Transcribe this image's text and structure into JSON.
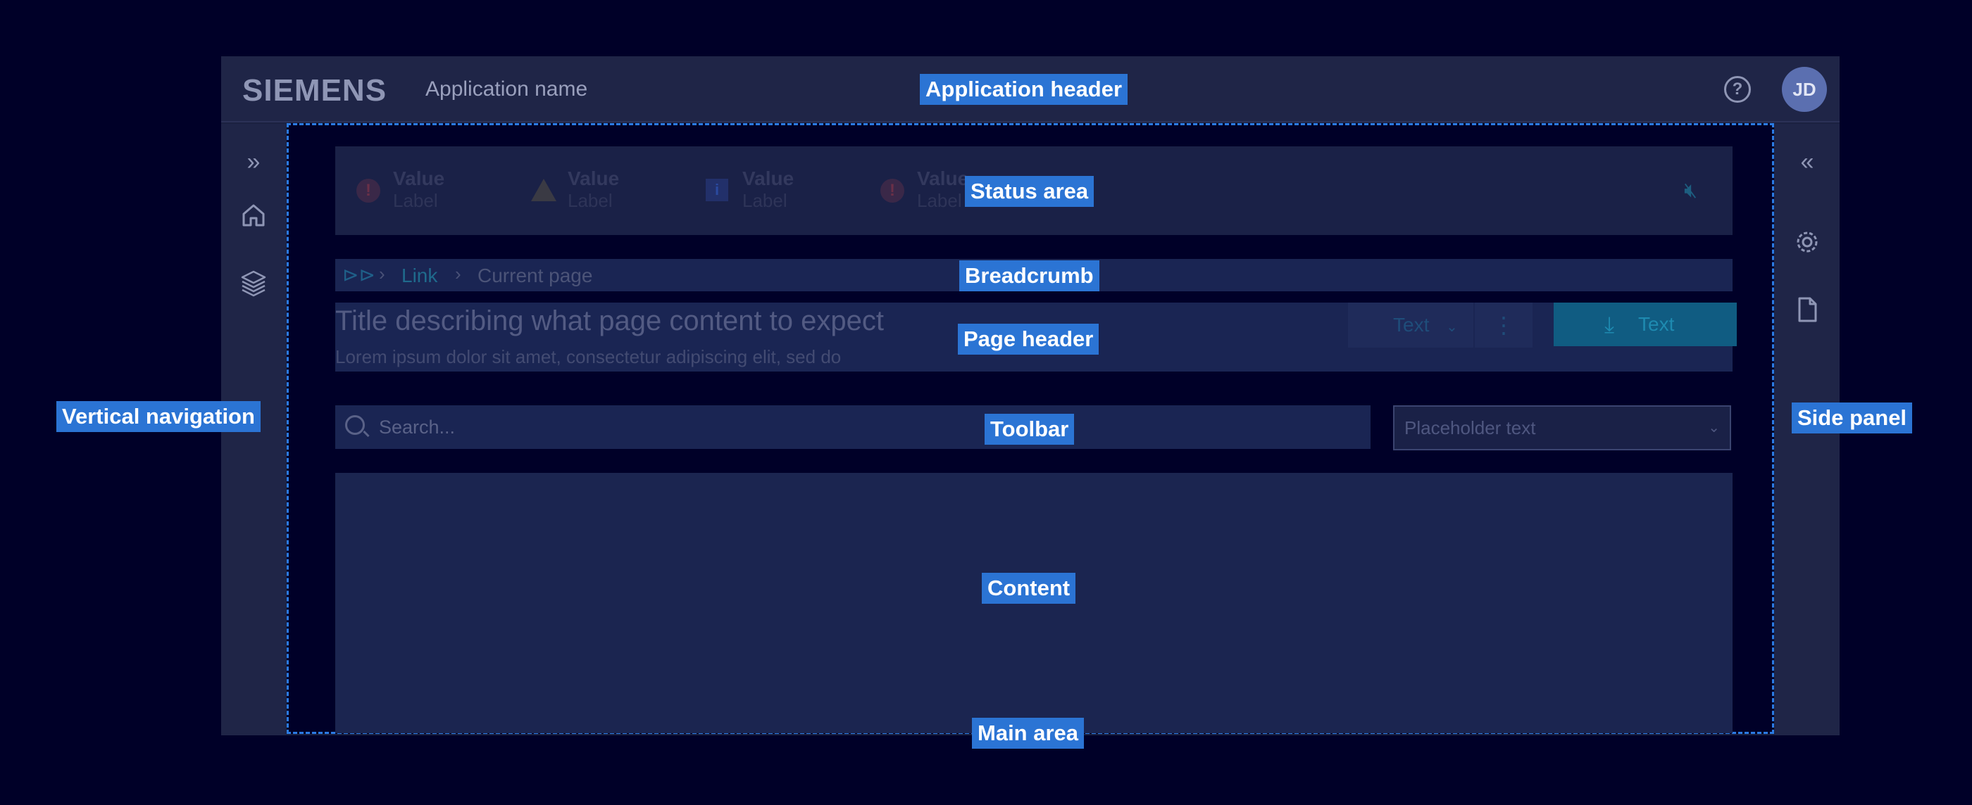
{
  "header": {
    "logo": "SIEMENS",
    "app_name": "Application name",
    "help_glyph": "?",
    "avatar_initials": "JD"
  },
  "icons": {
    "nav_expand": "chevrons-right-icon",
    "nav_home": "home-icon",
    "nav_layers": "layers-icon",
    "side_collapse": "chevrons-left-icon",
    "side_settings": "gear-icon",
    "side_document": "document-icon",
    "status_mute": "mute-icon",
    "breadcrumb_home": "breadcrumb-home-icon",
    "download": "download-icon",
    "search": "search-icon"
  },
  "status": {
    "items": [
      {
        "value": "Value",
        "label": "Label",
        "icon": "error-icon"
      },
      {
        "value": "Value",
        "label": "Label",
        "icon": "warning-icon"
      },
      {
        "value": "Value",
        "label": "Label",
        "icon": "info-icon"
      },
      {
        "value": "Value",
        "label": "Label",
        "icon": "error-icon"
      }
    ]
  },
  "breadcrumb": {
    "link": "Link",
    "current": "Current page"
  },
  "page_header": {
    "title": "Title describing what page content to expect",
    "subtitle": "Lorem ipsum dolor sit amet, consectetur adipiscing elit, sed do",
    "dropdown_button": "Text",
    "primary_button": "Text"
  },
  "toolbar": {
    "search_placeholder": "Search...",
    "select_placeholder": "Placeholder text"
  },
  "annotations": {
    "application_header": "Application header",
    "status_area": "Status area",
    "breadcrumb": "Breadcrumb",
    "page_header": "Page header",
    "vertical_navigation": "Vertical navigation",
    "toolbar": "Toolbar",
    "side_panel": "Side panel",
    "content": "Content",
    "main_area": "Main area"
  },
  "colors": {
    "background": "#000028",
    "frame": "#1b2140",
    "accent": "#2b74d4",
    "primary_button": "#105c82"
  }
}
